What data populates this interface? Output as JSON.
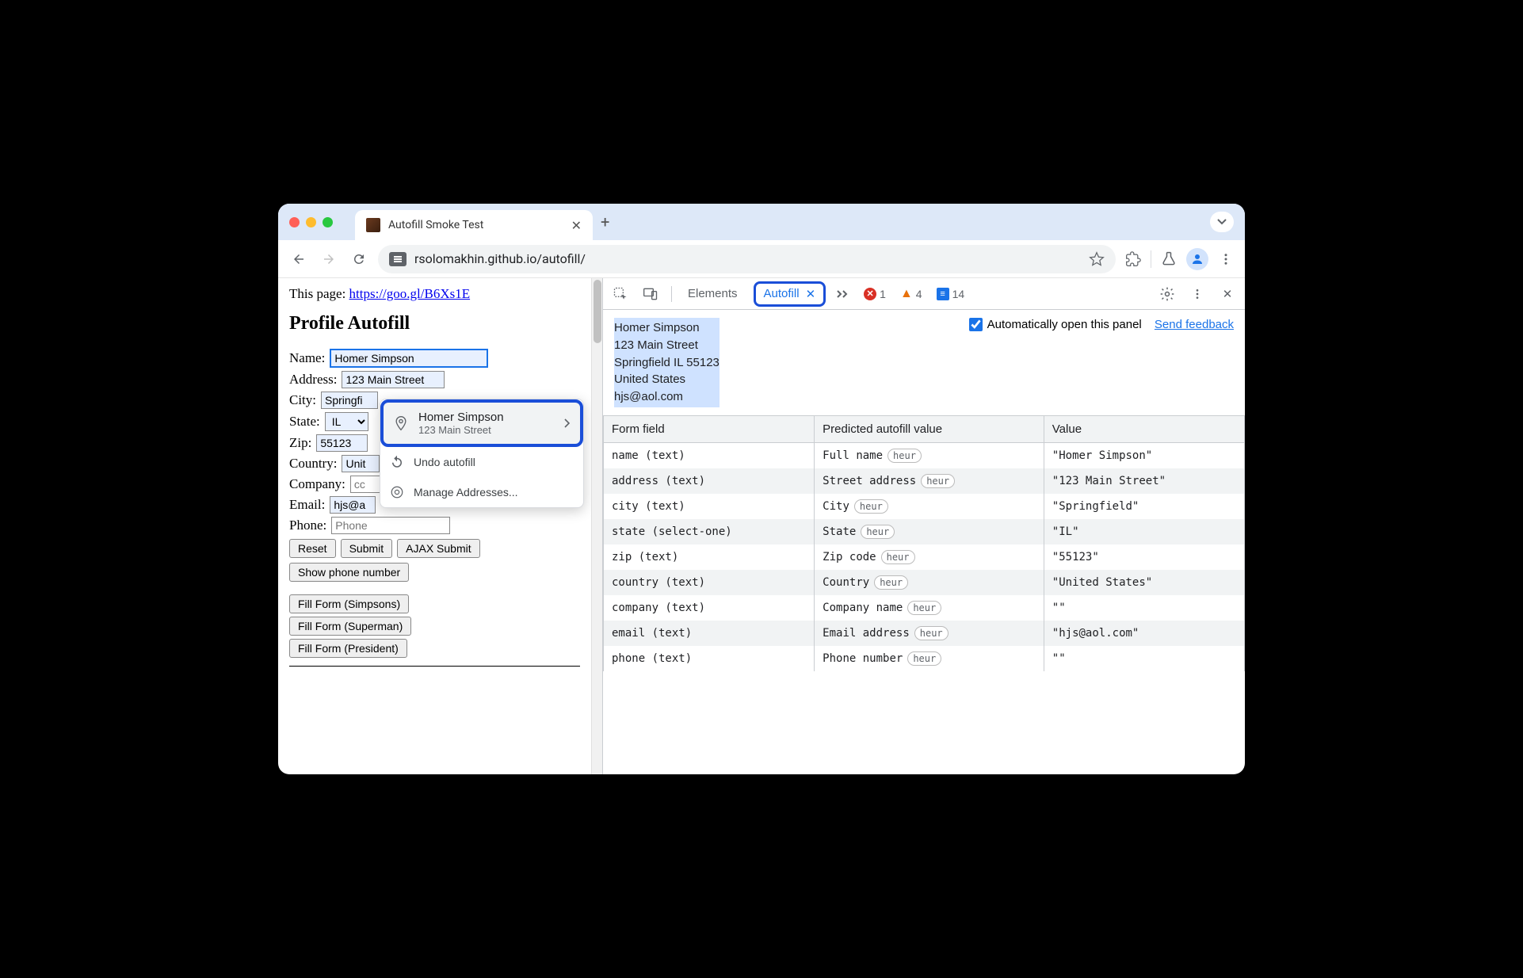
{
  "browser": {
    "tab_title": "Autofill Smoke Test",
    "url": "rsolomakhin.github.io/autofill/"
  },
  "page": {
    "link_prefix": "This page: ",
    "link_text": "https://goo.gl/B6Xs1E",
    "heading": "Profile Autofill",
    "form": {
      "name_label": "Name:",
      "name_value": "Homer Simpson",
      "address_label": "Address:",
      "address_value": "123 Main Street",
      "city_label": "City:",
      "city_value": "Springfi",
      "state_label": "State:",
      "state_value": "IL",
      "zip_label": "Zip:",
      "zip_value": "55123",
      "country_label": "Country:",
      "country_value": "Unit",
      "company_label": "Company:",
      "company_placeholder": "cc",
      "email_label": "Email:",
      "email_value": "hjs@a",
      "phone_label": "Phone:",
      "phone_placeholder": "Phone"
    },
    "buttons": {
      "reset": "Reset",
      "submit": "Submit",
      "ajax": "AJAX Submit",
      "show_phone": "Show phone number",
      "fill_simpsons": "Fill Form (Simpsons)",
      "fill_superman": "Fill Form (Superman)",
      "fill_president": "Fill Form (President)"
    }
  },
  "popup": {
    "title": "Homer Simpson",
    "subtitle": "123 Main Street",
    "undo": "Undo autofill",
    "manage": "Manage Addresses..."
  },
  "devtools": {
    "tabs": {
      "elements": "Elements",
      "autofill": "Autofill"
    },
    "counts": {
      "errors": "1",
      "warnings": "4",
      "info": "14"
    },
    "address_lines": [
      "Homer Simpson",
      "123 Main Street",
      "Springfield IL 55123",
      "United States",
      "hjs@aol.com"
    ],
    "auto_open_label": "Automatically open this panel",
    "feedback": "Send feedback",
    "table": {
      "h1": "Form field",
      "h2": "Predicted autofill value",
      "h3": "Value",
      "badge": "heur",
      "rows": [
        {
          "f": "name (text)",
          "p": "Full name",
          "v": "\"Homer Simpson\""
        },
        {
          "f": "address (text)",
          "p": "Street address",
          "v": "\"123 Main Street\""
        },
        {
          "f": "city (text)",
          "p": "City",
          "v": "\"Springfield\""
        },
        {
          "f": "state (select-one)",
          "p": "State",
          "v": "\"IL\""
        },
        {
          "f": "zip (text)",
          "p": "Zip code",
          "v": "\"55123\""
        },
        {
          "f": "country (text)",
          "p": "Country",
          "v": "\"United States\""
        },
        {
          "f": "company (text)",
          "p": "Company name",
          "v": "\"\""
        },
        {
          "f": "email (text)",
          "p": "Email address",
          "v": "\"hjs@aol.com\""
        },
        {
          "f": "phone (text)",
          "p": "Phone number",
          "v": "\"\""
        }
      ]
    }
  }
}
